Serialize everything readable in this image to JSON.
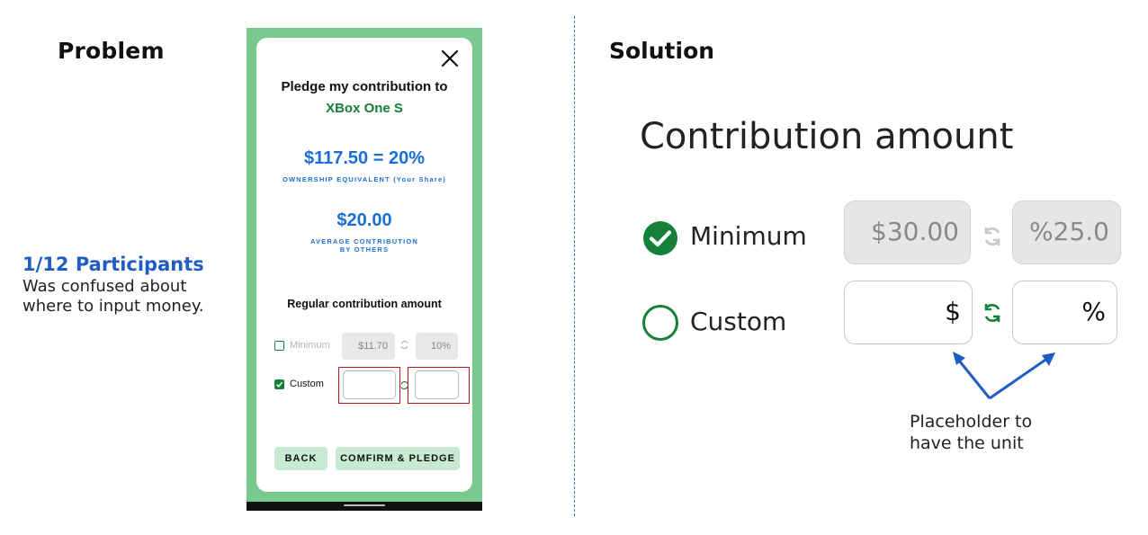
{
  "left": {
    "heading": "Problem",
    "finding_title": "1/12 Participants",
    "finding_lines": [
      "Was confused about",
      "where to input money."
    ]
  },
  "phone": {
    "pledge_title": "Pledge my contribution to",
    "product_name": "XBox One S",
    "share_amount": "$117.50 = 20%",
    "share_caption": "OWNERSHIP EQUIVALENT (Your Share)",
    "avg_amount": "$20.00",
    "avg_caption_lines": [
      "AVERAGE CONTRIBUTION",
      "BY OTHERS"
    ],
    "regular_title": "Regular contribution amount",
    "minimum_label": "Minimum",
    "minimum_amount": "$11.70",
    "minimum_percent": "10%",
    "custom_label": "Custom",
    "custom_checked": true,
    "minimum_checked": false,
    "back_label": "BACK",
    "confirm_label": "COMFIRM & PLEDGE"
  },
  "right": {
    "heading": "Solution",
    "contribution_title": "Contribution amount",
    "minimum_label": "Minimum",
    "minimum_amount": "$30.00",
    "minimum_percent": "%25.0",
    "custom_label": "Custom",
    "custom_amount_placeholder": "$",
    "custom_percent_placeholder": "%",
    "note_lines": [
      "Placeholder to",
      "have the unit"
    ]
  },
  "colors": {
    "brand_green": "#158038",
    "phone_bg": "#79c98e",
    "accent_blue": "#1a6fd6",
    "finding_blue": "#1f5cc4",
    "error_red": "#b11a1a"
  },
  "icons": [
    "close-icon",
    "sync-icon",
    "checkmark-icon",
    "arrow-icon"
  ]
}
